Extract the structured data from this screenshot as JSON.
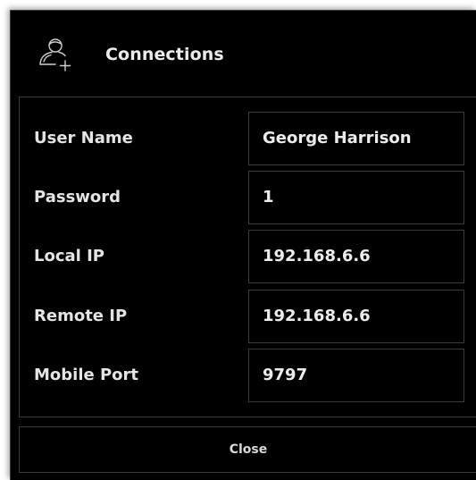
{
  "dialog": {
    "title": "Connections",
    "icon": "add-user-icon",
    "fields": [
      {
        "label": "User Name",
        "value": "George Harrison"
      },
      {
        "label": "Password",
        "value": "1"
      },
      {
        "label": "Local IP",
        "value": "192.168.6.6"
      },
      {
        "label": "Remote IP",
        "value": "192.168.6.6"
      },
      {
        "label": "Mobile Port",
        "value": "9797"
      }
    ],
    "close_label": "Close"
  },
  "colors": {
    "background": "#000000",
    "border": "#3a3a3a",
    "text": "#e8e8e8"
  }
}
